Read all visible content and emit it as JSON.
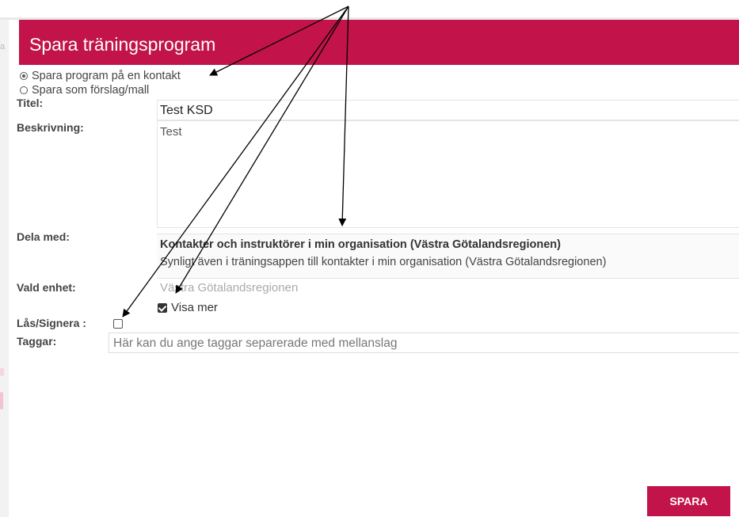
{
  "background": {
    "edge_char": "a"
  },
  "dialog": {
    "title": "Spara träningsprogram",
    "accent_color": "#c2144a"
  },
  "save_mode": {
    "options": [
      {
        "label": "Spara program på en kontakt",
        "selected": true
      },
      {
        "label": "Spara som förslag/mall",
        "selected": false
      }
    ]
  },
  "form": {
    "title_label": "Titel:",
    "title_value": "Test KSD",
    "description_label": "Beskrivning:",
    "description_value": "Test",
    "share_label": "Dela med:",
    "share_title": "Kontakter och instruktörer i min organisation (Västra Götalandsregionen)",
    "share_description": "Synligt även i träningsappen till kontakter i min organisation (Västra Götalandsregionen)",
    "unit_label": "Vald enhet:",
    "unit_value": "Västra Götalandsregionen",
    "show_more_label": "Visa mer",
    "show_more_checked": true,
    "lock_label": "Lås/Signera :",
    "lock_checked": false,
    "tags_label": "Taggar:",
    "tags_placeholder": "Här kan du ange taggar separerade med mellanslag"
  },
  "actions": {
    "save_label": "SPARA"
  },
  "annotations": {
    "arrow_count": 4,
    "arrow_color": "#000000"
  }
}
